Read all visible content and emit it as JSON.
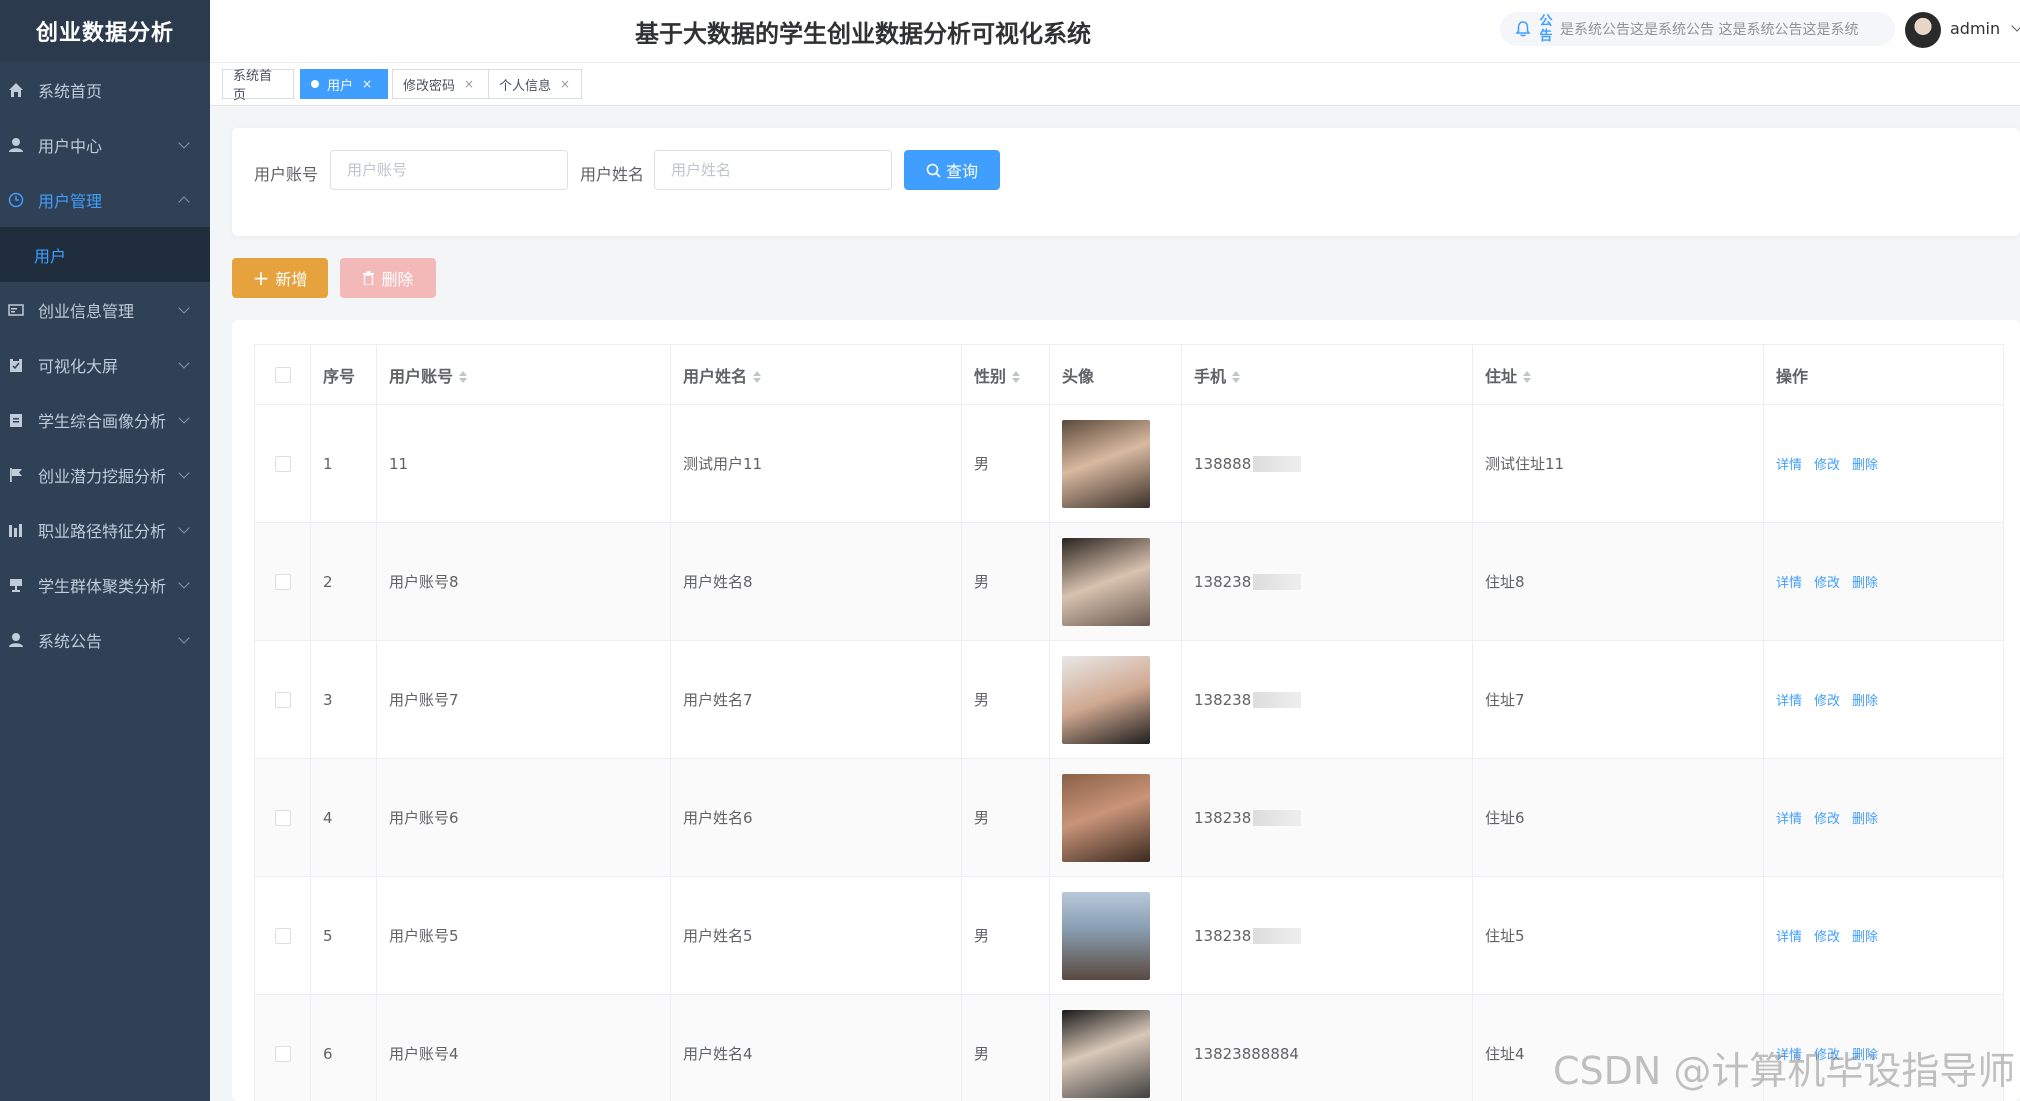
{
  "sidebar": {
    "title": "创业数据分析",
    "items": [
      {
        "label": "系统首页",
        "icon": "home-icon"
      },
      {
        "label": "用户中心",
        "icon": "user-icon"
      },
      {
        "label": "用户管理",
        "icon": "clock-icon"
      },
      {
        "label": "创业信息管理",
        "icon": "card-icon"
      },
      {
        "label": "可视化大屏",
        "icon": "clipboard-icon"
      },
      {
        "label": "学生综合画像分析",
        "icon": "clipboard-icon"
      },
      {
        "label": "创业潜力挖掘分析",
        "icon": "flag-icon"
      },
      {
        "label": "职业路径特征分析",
        "icon": "bar-chart-icon"
      },
      {
        "label": "学生群体聚类分析",
        "icon": "trophy-icon"
      },
      {
        "label": "系统公告",
        "icon": "user-icon"
      }
    ],
    "sub_item": "用户"
  },
  "header": {
    "title": "基于大数据的学生创业数据分析可视化系统",
    "notice_label": "公告",
    "notice_text": "是系统公告这是系统公告    这是系统公告这是系统",
    "username": "admin"
  },
  "tabs": [
    {
      "label": "系统首页"
    },
    {
      "label": "用户"
    },
    {
      "label": "修改密码"
    },
    {
      "label": "个人信息"
    }
  ],
  "tab_close": "×",
  "search": {
    "account_label": "用户账号",
    "account_placeholder": "用户账号",
    "name_label": "用户姓名",
    "name_placeholder": "用户姓名",
    "query_button": "查询"
  },
  "actions": {
    "add": "新增",
    "delete": "删除"
  },
  "table": {
    "headers": {
      "index": "序号",
      "account": "用户账号",
      "name": "用户姓名",
      "gender": "性别",
      "avatar": "头像",
      "phone": "手机",
      "address": "住址",
      "ops": "操作"
    },
    "op_labels": {
      "detail": "详情",
      "edit": "修改",
      "delete": "删除"
    },
    "rows": [
      {
        "index": "1",
        "account": "11",
        "name": "测试用户11",
        "gender": "男",
        "phone": "138888",
        "address": "测试住址11"
      },
      {
        "index": "2",
        "account": "用户账号8",
        "name": "用户姓名8",
        "gender": "男",
        "phone": "138238",
        "address": "住址8"
      },
      {
        "index": "3",
        "account": "用户账号7",
        "name": "用户姓名7",
        "gender": "男",
        "phone": "138238",
        "address": "住址7"
      },
      {
        "index": "4",
        "account": "用户账号6",
        "name": "用户姓名6",
        "gender": "男",
        "phone": "138238",
        "address": "住址6"
      },
      {
        "index": "5",
        "account": "用户账号5",
        "name": "用户姓名5",
        "gender": "男",
        "phone": "138238",
        "address": "住址5"
      },
      {
        "index": "6",
        "account": "用户账号4",
        "name": "用户姓名4",
        "gender": "男",
        "phone": "13823888884",
        "address": "住址4"
      }
    ]
  },
  "watermark": "CSDN @计算机毕设指导师"
}
